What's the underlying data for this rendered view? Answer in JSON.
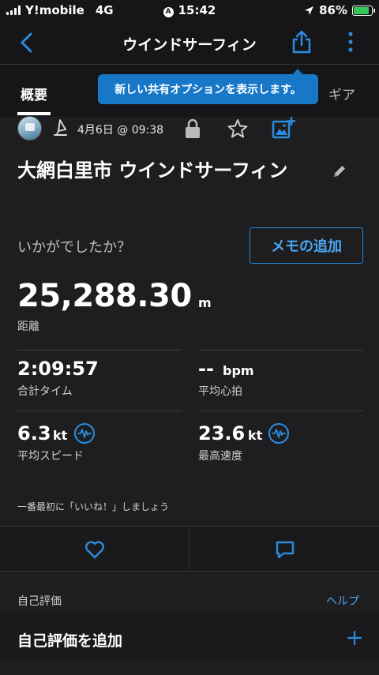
{
  "status_bar": {
    "carrier": "Y!mobile",
    "network": "4G",
    "time": "15:42",
    "battery": "86%",
    "battery_level": 0.86
  },
  "header": {
    "title": "ウインドサーフィン"
  },
  "tabs": [
    {
      "label": "概要"
    },
    {
      "label": "ギア"
    }
  ],
  "tooltip": {
    "text": "新しい共有オプションを表示します。"
  },
  "activity": {
    "date": "4月6日 @ 09:38",
    "title": "大網白里市 ウインドサーフィン",
    "prompt": "いかがでしたか？",
    "memo_button": "メモの追加"
  },
  "stats": {
    "distance": {
      "value": "25,288.30",
      "unit": "m",
      "label": "距離"
    },
    "total_time": {
      "value": "2:09:57",
      "label": "合計タイム"
    },
    "avg_heart_rate": {
      "value": "--",
      "unit": "bpm",
      "label": "平均心拍"
    },
    "avg_speed": {
      "value": "6.3",
      "unit": "kt",
      "label": "平均スピード"
    },
    "max_speed": {
      "value": "23.6",
      "unit": "kt",
      "label": "最高速度"
    }
  },
  "kudos_prompt": "一番最初に「いいね！」しましょう",
  "self_evaluation": {
    "section_label": "自己評価",
    "help": "ヘルプ",
    "add_label": "自己評価を追加"
  },
  "colors": {
    "accent": "#1f8ae0",
    "tooltip": "#1778c8",
    "background": "#1e1e20",
    "battery": "#34c759"
  },
  "icons": [
    "back-icon",
    "share-icon",
    "more-icon",
    "windsurf-icon",
    "lock-icon",
    "star-icon",
    "add-photo-icon",
    "edit-icon",
    "heart-icon",
    "comment-icon",
    "plus-icon",
    "wave-icon"
  ]
}
